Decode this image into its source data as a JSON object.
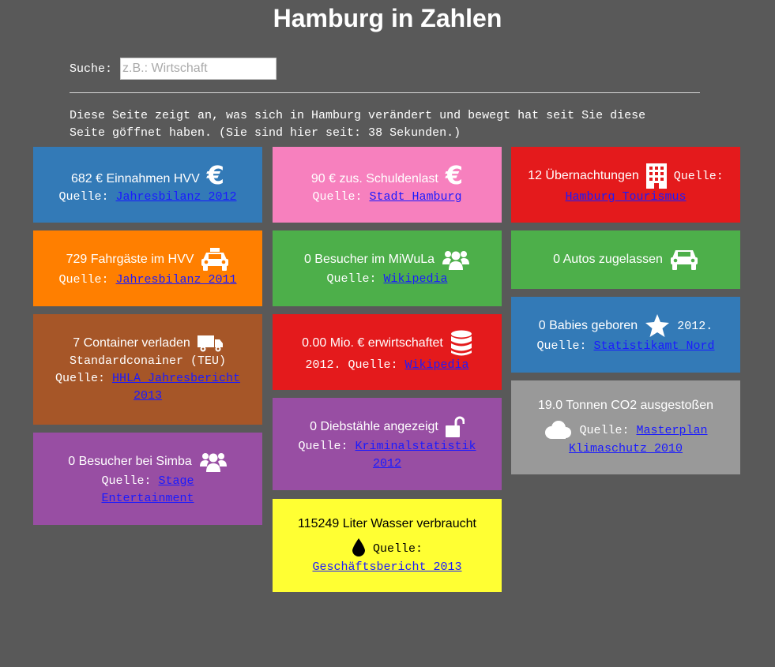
{
  "page": {
    "title": "Hamburg in Zahlen"
  },
  "search": {
    "label": "Suche:",
    "placeholder": "z.B.: Wirtschaft",
    "value": ""
  },
  "intro": {
    "line1": "Diese Seite zeigt an, was sich in Hamburg verändert und bewegt hat seit Sie diese",
    "line2": "Seite göffnet haben. (Sie sind hier seit: 38 Sekunden.)"
  },
  "colors": {
    "blue": "#337ab7",
    "pink": "#f780be",
    "red": "#e41a1c",
    "orange": "#ff7f00",
    "green": "#4daf4a",
    "brown": "#a65628",
    "purple": "#984ea3",
    "gray": "#999999",
    "yellow": "#ffff33"
  },
  "tiles": {
    "hvv_income": {
      "text": "682 € Einnahmen HVV",
      "icon": "euro-icon",
      "source_label": "Quelle:",
      "source_link": "Jahresbilanz 2012"
    },
    "hvv_passengers": {
      "text": "729 Fahrgäste im HVV",
      "icon": "taxi-icon",
      "source_label": "Quelle:",
      "source_link": "Jahresbilanz 2011"
    },
    "container": {
      "text": "7 Container verladen",
      "icon": "truck-icon",
      "unit": "Standardconainer (TEU)",
      "source_label": "Quelle:",
      "source_link_1": "HHLA Jahresbericht",
      "source_link_2": "2013"
    },
    "simba": {
      "text": "0 Besucher bei Simba",
      "icon": "users-icon",
      "source_label": "Quelle:",
      "source_link_1": "Stage",
      "source_link_2": "Entertainment"
    },
    "debt": {
      "text": "90 € zus. Schuldenlast",
      "icon": "euro-icon",
      "source_label": "Quelle:",
      "source_link": "Stadt Hamburg"
    },
    "miwula": {
      "text": "0 Besucher im MiWuLa",
      "icon": "users-icon",
      "source_label": "Quelle:",
      "source_link": "Wikipedia"
    },
    "revenue": {
      "text": "0.00 Mio. € erwirtschaftet",
      "icon": "database-icon",
      "year": "2012.",
      "source_label": "Quelle:",
      "source_link": "Wikipedia"
    },
    "theft": {
      "text": "0 Diebstähle angezeigt",
      "icon": "unlock-icon",
      "source_label": "Quelle:",
      "source_link_1": "Kriminalstatistik",
      "source_link_2": "2012"
    },
    "water": {
      "text": "115249 Liter Wasser verbraucht",
      "icon": "tint-icon",
      "source_label": "Quelle:",
      "source_link": "Geschäftsbericht 2013"
    },
    "overnight": {
      "text": "12 Übernachtungen",
      "icon": "building-icon",
      "source_label": "Quelle:",
      "source_link": "Hamburg Tourismus"
    },
    "cars": {
      "text": "0 Autos zugelassen",
      "icon": "car-icon"
    },
    "babies": {
      "text": "0 Babies geboren",
      "icon": "star-icon",
      "year": "2012.",
      "source_label": "Quelle:",
      "source_link": "Statistikamt Nord"
    },
    "co2": {
      "text": "19.0 Tonnen CO2 ausgestoßen",
      "icon": "cloud-icon",
      "source_label": "Quelle:",
      "source_link_1": "Masterplan",
      "source_link_2": "Klimaschutz 2010"
    }
  }
}
